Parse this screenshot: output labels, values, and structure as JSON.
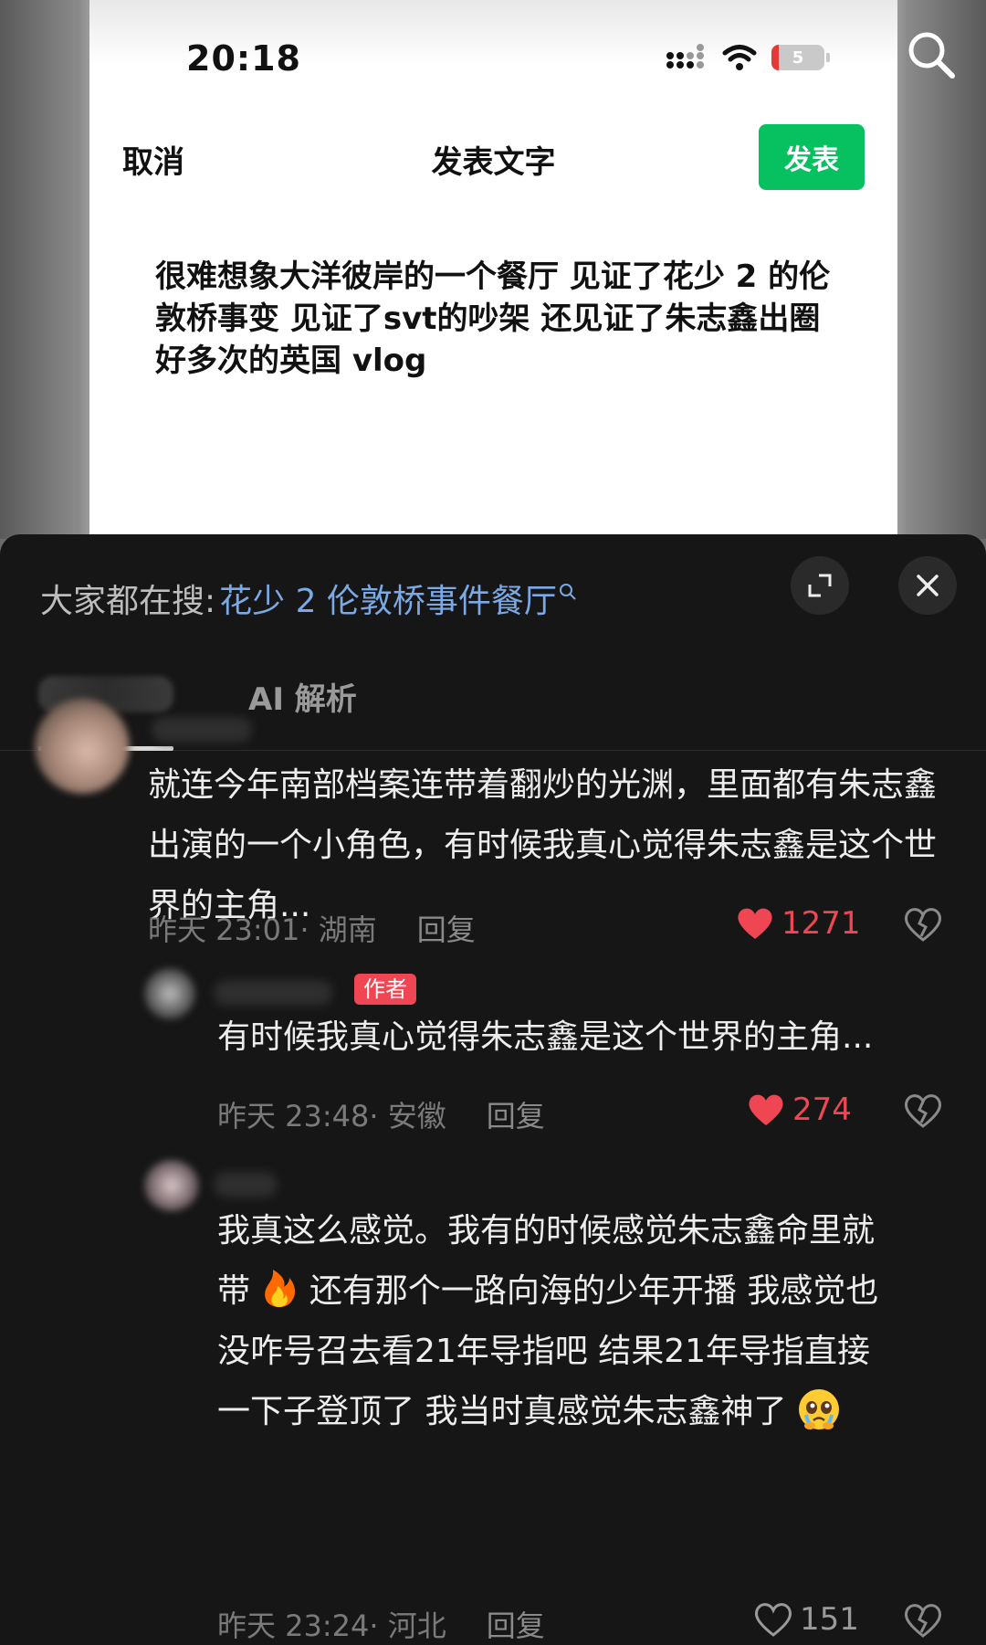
{
  "status_bar": {
    "time": "20:18",
    "battery": "5"
  },
  "post_editor": {
    "cancel_label": "取消",
    "title": "发表文字",
    "publish_label": "发表",
    "text": "很难想象大洋彼岸的一个餐厅 见证了花少 2 的伦敦桥事变 见证了svt的吵架 还见证了朱志鑫出圈好多次的英国 vlog"
  },
  "hot_search": {
    "label": "大家都在搜:",
    "query": "花少 2 伦敦桥事件餐厅"
  },
  "tabs": {
    "ai_label": "AI 解析"
  },
  "comments": [
    {
      "text": "就连今年南部档案连带着翻炒的光渊，里面都有朱志鑫出演的一个小角色，有时候我真心觉得朱志鑫是这个世界的主角...",
      "meta": "昨天 23:01· 湖南",
      "reply_label": "回复",
      "likes": "1271"
    },
    {
      "badge": "作者",
      "text": "有时候我真心觉得朱志鑫是这个世界的主角...",
      "meta": "昨天 23:48· 安徽",
      "reply_label": "回复",
      "likes": "274"
    },
    {
      "text_1": "我真这么感觉。我有的时候感觉朱志鑫命里就",
      "text_2a": "带",
      "text_2b": "还有那个一路向海的少年开播 我感觉也",
      "text_3": "没咋号召去看21年导指吧 结果21年导指直接",
      "text_4": "一下子登顶了 我当时真感觉朱志鑫神了",
      "meta": "昨天 23:24· 河北",
      "reply_label": "回复",
      "likes": "151"
    }
  ]
}
